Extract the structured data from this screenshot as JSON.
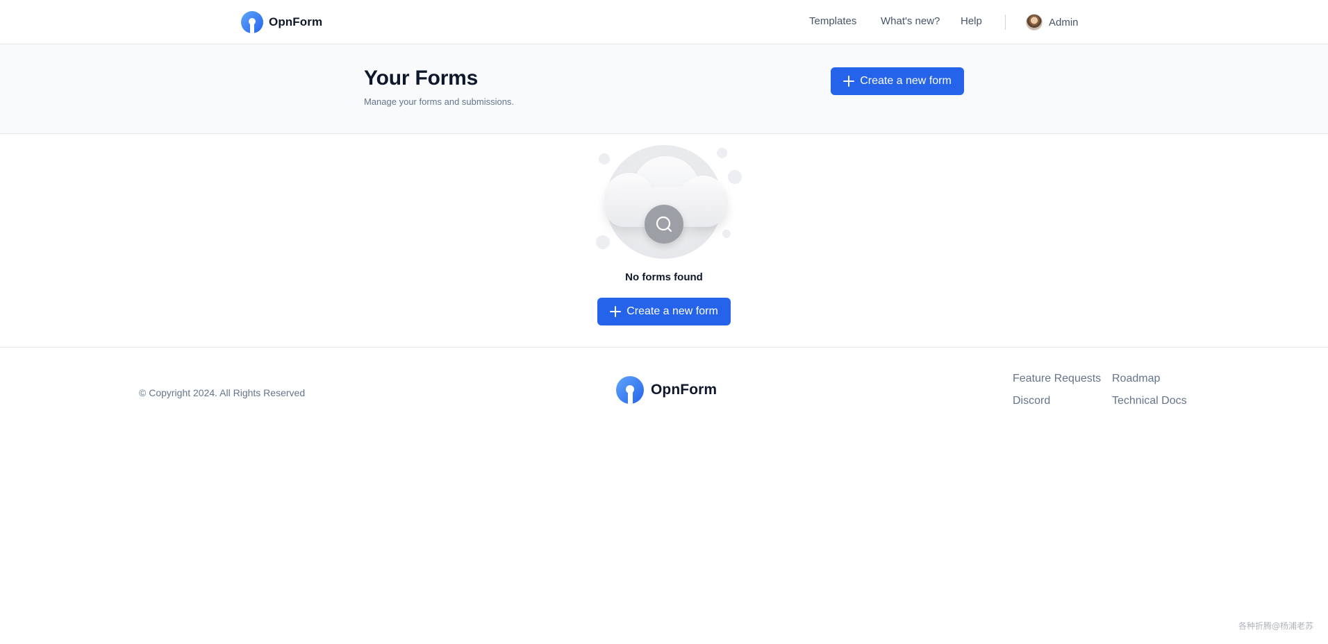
{
  "nav": {
    "brand": "OpnForm",
    "links": [
      "Templates",
      "What's new?",
      "Help"
    ],
    "user": "Admin"
  },
  "header": {
    "title": "Your Forms",
    "subtitle": "Manage your forms and submissions.",
    "create_button": "Create a new form"
  },
  "empty_state": {
    "title": "No forms found",
    "create_button": "Create a new form"
  },
  "footer": {
    "copyright": "© Copyright 2024. All Rights Reserved",
    "brand": "OpnForm",
    "links": [
      "Feature Requests",
      "Roadmap",
      "Discord",
      "Technical Docs"
    ]
  },
  "watermark": "各种折腾@杨浦老苏",
  "colors": {
    "accent": "#2563eb",
    "header_band": "#f8fafc",
    "muted_text": "#64748b"
  },
  "icons": [
    "opnform-logo-icon",
    "plus-icon",
    "search-icon",
    "user-avatar"
  ]
}
